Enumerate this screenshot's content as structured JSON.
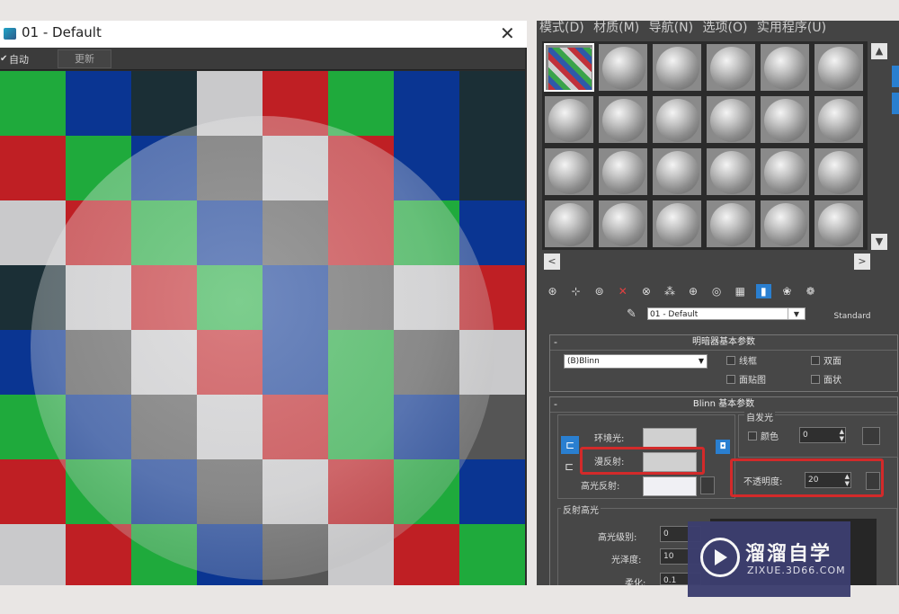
{
  "preview_window": {
    "title": "01 - Default",
    "close_glyph": "✕",
    "auto_label": "自动",
    "update_label": "更新",
    "checker_colors": [
      "#1faa3c",
      "#0a3592",
      "#1b2f36",
      "#c9c9cb",
      "#bf1f24",
      "#555555"
    ]
  },
  "menu": [
    "模式(D)",
    "材质(M)",
    "导航(N)",
    "选项(O)",
    "实用程序(U)"
  ],
  "material_slots": {
    "rows": 4,
    "cols": 6,
    "active_index": 0
  },
  "scroll": {
    "up": "▲",
    "down": "▼",
    "left": "<",
    "right": ">"
  },
  "toolbar_icons": [
    "get-material-icon",
    "put-to-scene-icon",
    "assign-material-icon",
    "delete-icon",
    "copy-material-icon",
    "make-unique-icon",
    "put-to-library-icon",
    "material-id-icon",
    "show-in-viewport-icon",
    "show-end-result-icon",
    "go-to-parent-icon",
    "go-forward-icon"
  ],
  "material": {
    "name": "01 - Default",
    "type_button": "Standard",
    "dropdown_glyph": "▼"
  },
  "shader_basic": {
    "header": "明暗器基本参数",
    "shader": "(B)Blinn",
    "wire": "线框",
    "two_sided": "双面",
    "face_map": "面贴图",
    "faceted": "面状"
  },
  "blinn_basic": {
    "header": "Blinn 基本参数",
    "self_illum": "自发光",
    "color_label": "颜色",
    "self_illum_value": "0",
    "ambient": "环境光:",
    "diffuse": "漫反射:",
    "specular": "高光反射:",
    "opacity_label": "不透明度:",
    "opacity_value": "20",
    "lock_glyph": "🔒"
  },
  "specular_highlights": {
    "header": "反射高光",
    "level_label": "高光级别:",
    "level_value": "0",
    "gloss_label": "光泽度:",
    "gloss_value": "10",
    "soften_label": "柔化:",
    "soften_value": "0.1"
  },
  "watermark": {
    "title": "溜溜自学",
    "url": "ZIXUE.3D66.COM"
  }
}
